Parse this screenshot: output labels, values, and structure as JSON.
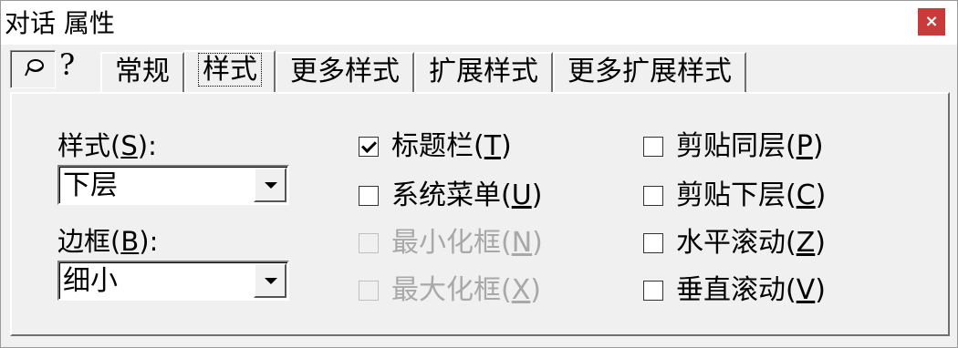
{
  "window": {
    "title": "对话 属性",
    "close_label": "×"
  },
  "toolbar": {
    "pin_icon": "pushpin-icon",
    "help_label": "?"
  },
  "tabs": [
    {
      "label": "常规",
      "selected": false
    },
    {
      "label": "样式",
      "selected": true
    },
    {
      "label": "更多样式",
      "selected": false
    },
    {
      "label": "扩展样式",
      "selected": false
    },
    {
      "label": "更多扩展样式",
      "selected": false
    }
  ],
  "style_field": {
    "label": "样式",
    "hotkey": "S",
    "value": "下层"
  },
  "border_field": {
    "label": "边框",
    "hotkey": "B",
    "value": "细小"
  },
  "checkboxes_middle": [
    {
      "label": "标题栏",
      "hotkey": "T",
      "checked": true,
      "enabled": true
    },
    {
      "label": "系统菜单",
      "hotkey": "U",
      "checked": false,
      "enabled": true
    },
    {
      "label": "最小化框",
      "hotkey": "N",
      "checked": false,
      "enabled": false
    },
    {
      "label": "最大化框",
      "hotkey": "X",
      "checked": false,
      "enabled": false
    }
  ],
  "checkboxes_right": [
    {
      "label": "剪贴同层",
      "hotkey": "P",
      "checked": false,
      "enabled": true
    },
    {
      "label": "剪贴下层",
      "hotkey": "C",
      "checked": false,
      "enabled": true
    },
    {
      "label": "水平滚动",
      "hotkey": "Z",
      "checked": false,
      "enabled": true
    },
    {
      "label": "垂直滚动",
      "hotkey": "V",
      "checked": false,
      "enabled": true
    }
  ],
  "colors": {
    "close_button": "#c83b3b",
    "face": "#f0f0f0",
    "disabled_text": "#a8a8a8"
  }
}
